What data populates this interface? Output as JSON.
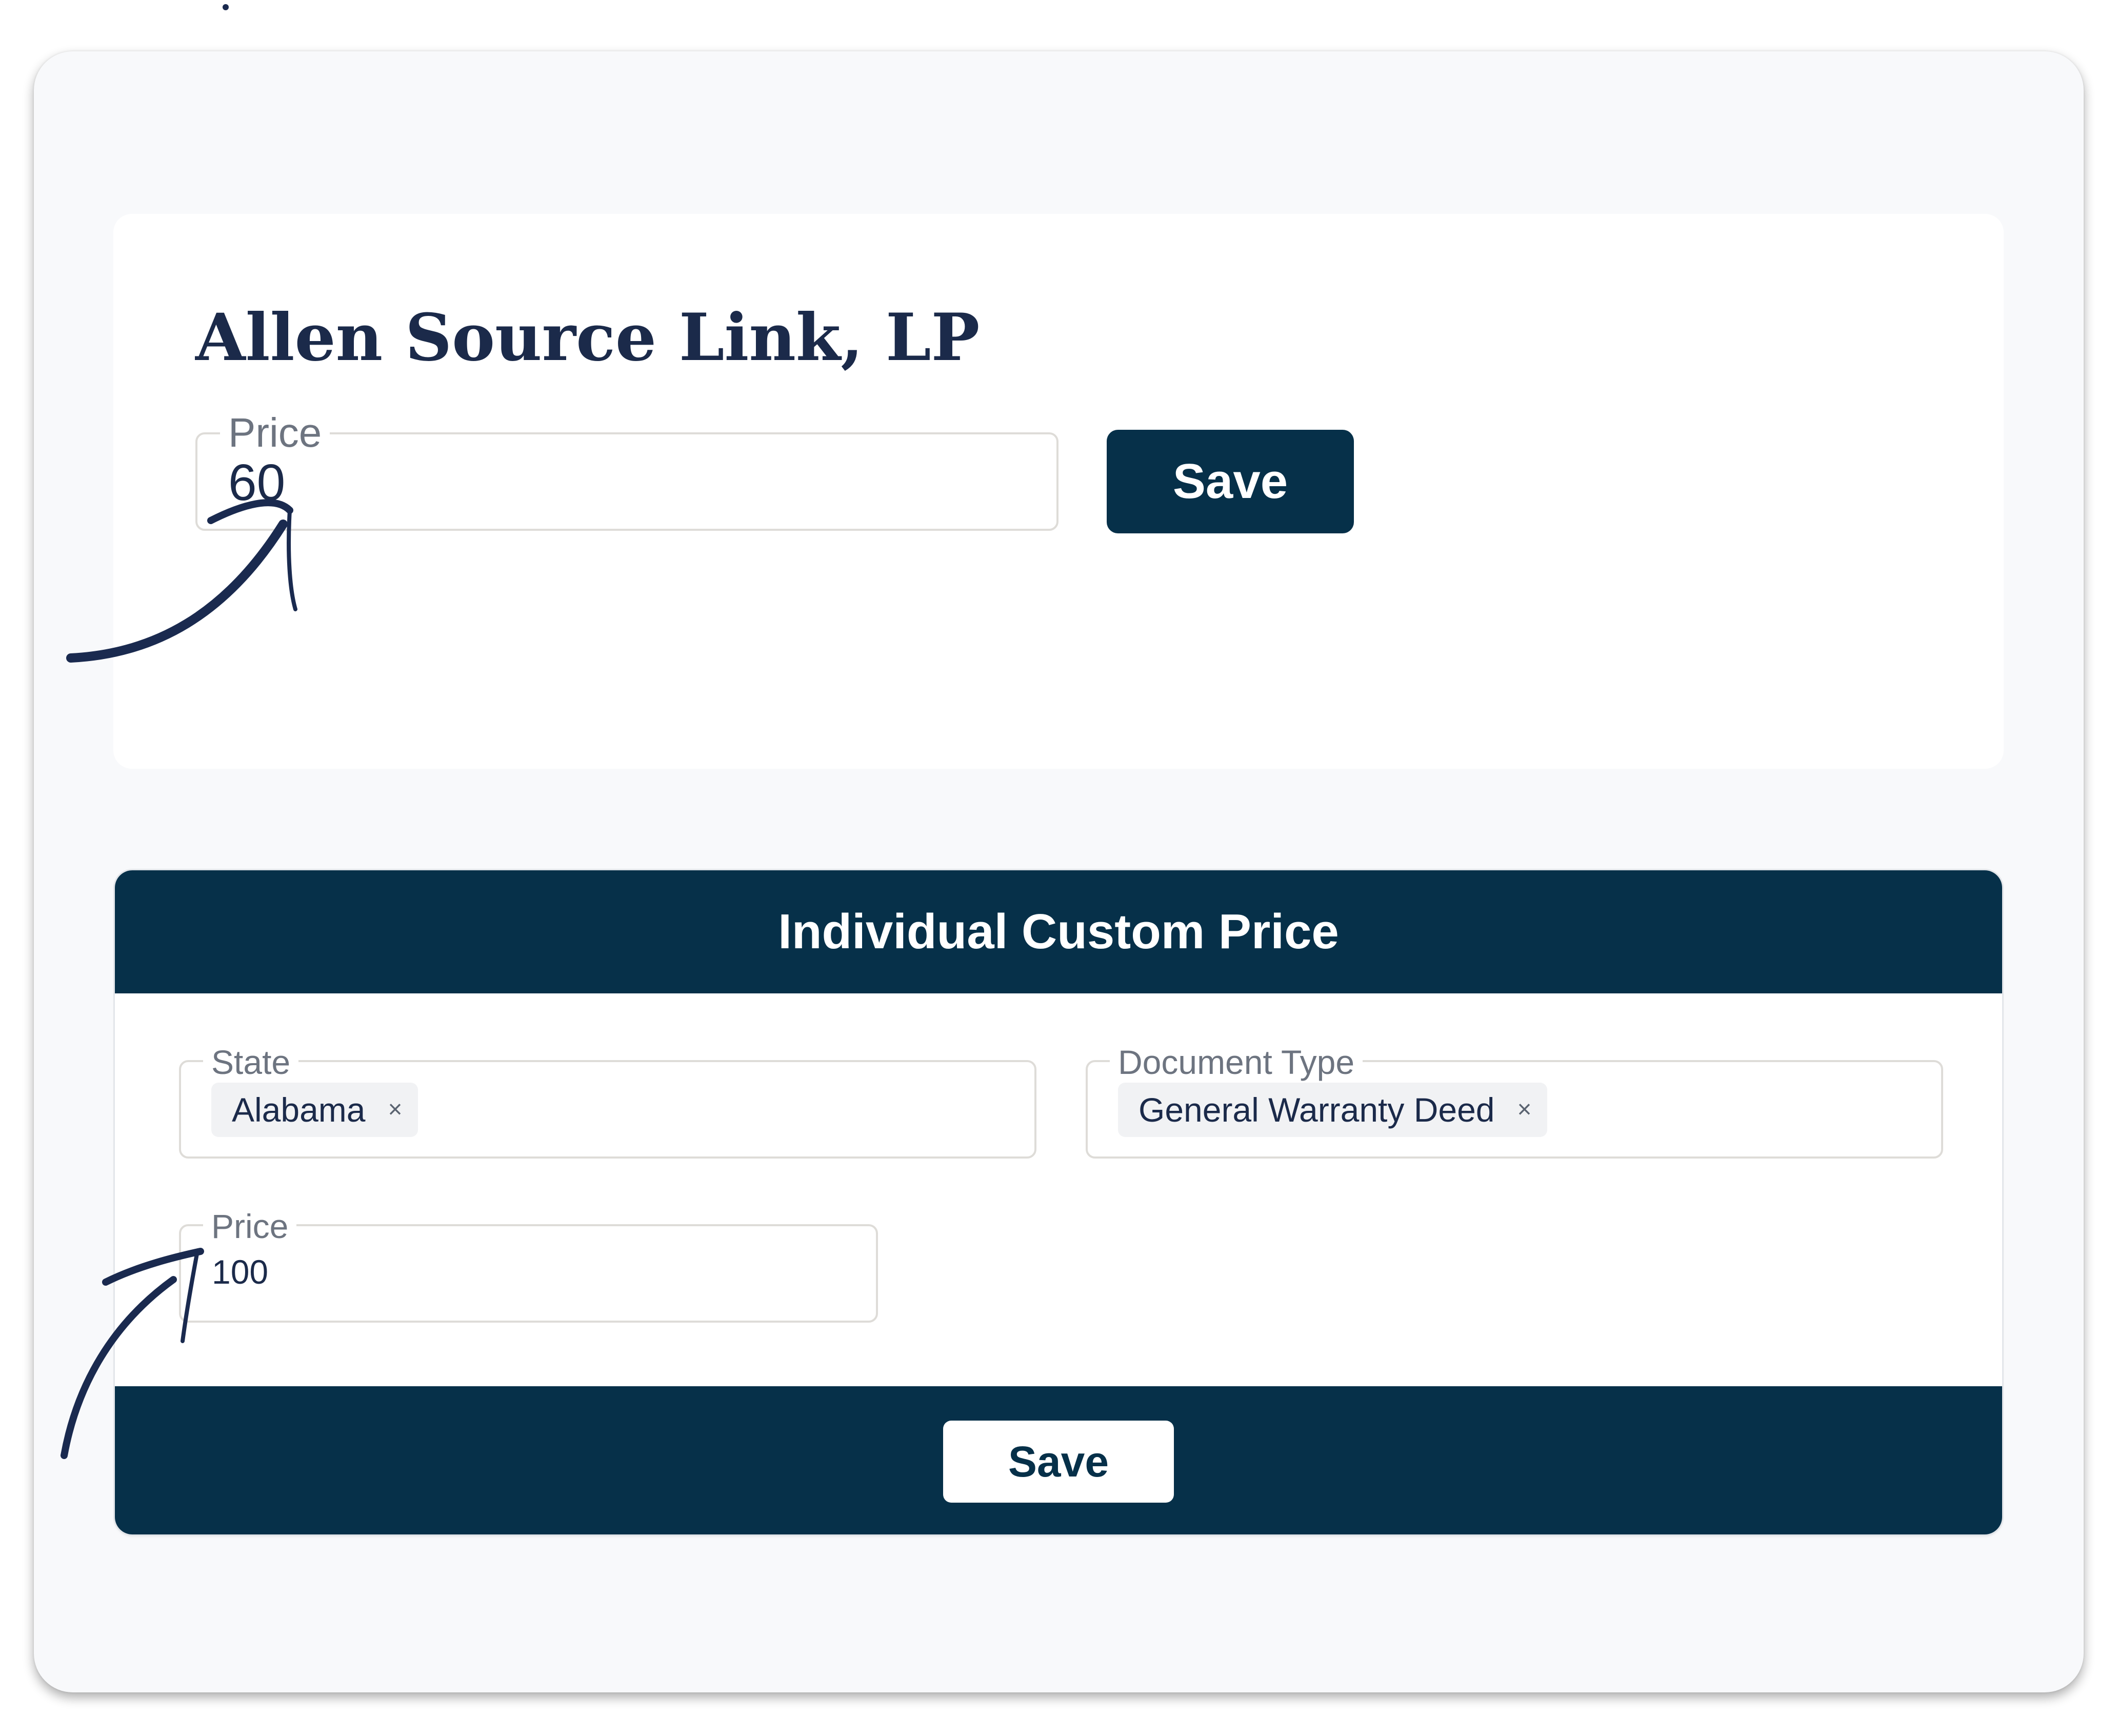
{
  "company": {
    "name": "Allen Source Link, LP",
    "price_label": "Price",
    "price_value": "60",
    "save_label": "Save"
  },
  "custom_price": {
    "title": "Individual Custom Price",
    "state": {
      "label": "State",
      "selected": [
        {
          "label": "Alabama",
          "remove": "×"
        }
      ]
    },
    "document_type": {
      "label": "Document Type",
      "selected": [
        {
          "label": "General Warranty Deed",
          "remove": "×"
        }
      ]
    },
    "price": {
      "label": "Price",
      "value": "100"
    },
    "save_label": "Save"
  },
  "colors": {
    "primary": "#063049",
    "heading": "#1b2a4a",
    "annotation": "#1a2a4f"
  },
  "annotations": [
    "hand-drawn-arrow-icon",
    "hand-drawn-arrow-icon"
  ]
}
